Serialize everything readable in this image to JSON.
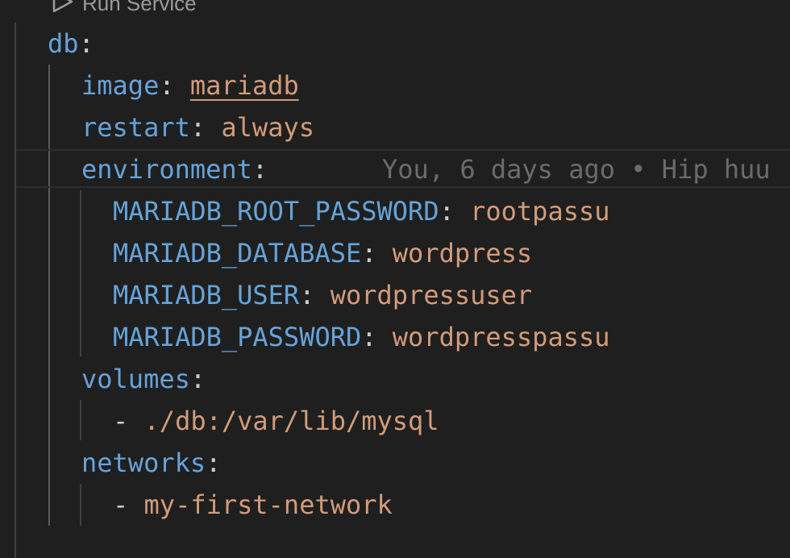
{
  "codelens": {
    "run_label": "Run Service",
    "icon": "play-icon"
  },
  "blame": {
    "text": "You, 6 days ago • Hip huu"
  },
  "lines": {
    "db_key": "db",
    "colon": ":",
    "image_key": "image",
    "image_value": "mariadb",
    "restart_key": "restart",
    "restart_value": "always",
    "environment_key": "environment",
    "env_root_password_key": "MARIADB_ROOT_PASSWORD",
    "env_root_password_value": "rootpassu",
    "env_database_key": "MARIADB_DATABASE",
    "env_database_value": "wordpress",
    "env_user_key": "MARIADB_USER",
    "env_user_value": "wordpressuser",
    "env_password_key": "MARIADB_PASSWORD",
    "env_password_value": "wordpresspassu",
    "volumes_key": "volumes",
    "volume_dash": "-",
    "volume_value": "./db:/var/lib/mysql",
    "networks_key": "networks",
    "network_dash": "-",
    "network_value": "my-first-network"
  },
  "colors": {
    "background": "#1f1f1f",
    "key": "#66a3d9",
    "string": "#d39b7a",
    "punctuation": "#cccccc",
    "blame": "#6b6b6b"
  }
}
